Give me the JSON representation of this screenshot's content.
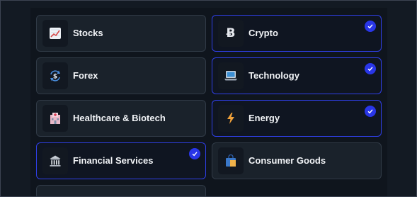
{
  "categories": [
    {
      "label": "Stocks",
      "icon": "chart-increasing-icon",
      "selected": false
    },
    {
      "label": "Crypto",
      "icon": "bitcoin-icon",
      "selected": true
    },
    {
      "label": "Forex",
      "icon": "currency-exchange-icon",
      "selected": false
    },
    {
      "label": "Technology",
      "icon": "laptop-icon",
      "selected": true
    },
    {
      "label": "Healthcare & Biotech",
      "icon": "hospital-icon",
      "selected": false
    },
    {
      "label": "Energy",
      "icon": "lightning-icon",
      "selected": true
    },
    {
      "label": "Financial Services",
      "icon": "bank-icon",
      "selected": true
    },
    {
      "label": "Consumer Goods",
      "icon": "shopping-bag-icon",
      "selected": false
    }
  ],
  "colors": {
    "selected_border": "#2f3fe6",
    "check_fill": "#2936e8",
    "card_bg": "#1a222b",
    "page_bg": "#121821"
  }
}
